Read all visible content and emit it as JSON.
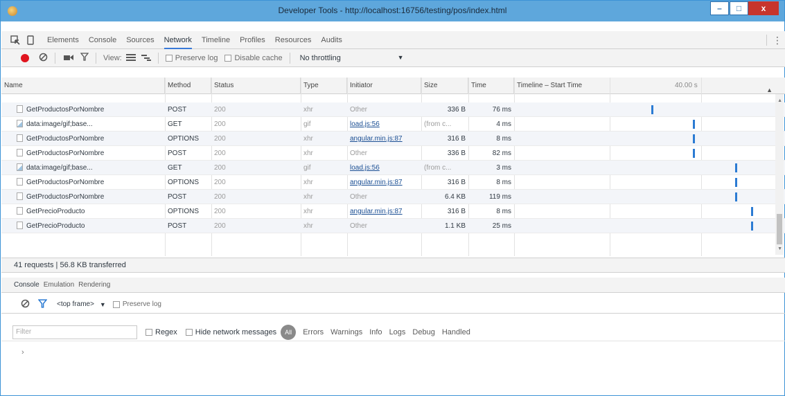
{
  "window": {
    "title": "Developer Tools - http://localhost:16756/testing/pos/index.html",
    "minimize": "–",
    "maximize": "□",
    "close": "x"
  },
  "tabs": [
    "Elements",
    "Console",
    "Sources",
    "Network",
    "Timeline",
    "Profiles",
    "Resources",
    "Audits"
  ],
  "active_tab": "Network",
  "network_toolbar": {
    "view_label": "View:",
    "preserve_log": "Preserve log",
    "disable_cache": "Disable cache",
    "throttling": "No throttling"
  },
  "columns": {
    "name": "Name",
    "method": "Method",
    "status": "Status",
    "type": "Type",
    "initiator": "Initiator",
    "size": "Size",
    "time": "Time",
    "timeline": "Timeline – Start Time",
    "ms_marker": "40.00 s"
  },
  "requests": [
    {
      "name": "GetProductosPorNombre",
      "method": "POST",
      "status": "200",
      "type": "xhr",
      "initiator": "Other",
      "initiator_link": false,
      "size": "336 B",
      "time": "76 ms",
      "icon": "doc",
      "wf": 0.52
    },
    {
      "name": "data:image/gif;base...",
      "method": "GET",
      "status": "200",
      "type": "gif",
      "initiator": "load.js:56",
      "initiator_link": true,
      "size": "(from c...",
      "time": "4 ms",
      "icon": "img",
      "wf": 0.68
    },
    {
      "name": "GetProductosPorNombre",
      "method": "OPTIONS",
      "status": "200",
      "type": "xhr",
      "initiator": "angular.min.js:87",
      "initiator_link": true,
      "size": "316 B",
      "time": "8 ms",
      "icon": "doc",
      "wf": 0.68
    },
    {
      "name": "GetProductosPorNombre",
      "method": "POST",
      "status": "200",
      "type": "xhr",
      "initiator": "Other",
      "initiator_link": false,
      "size": "336 B",
      "time": "82 ms",
      "icon": "doc",
      "wf": 0.68
    },
    {
      "name": "data:image/gif;base...",
      "method": "GET",
      "status": "200",
      "type": "gif",
      "initiator": "load.js:56",
      "initiator_link": true,
      "size": "(from c...",
      "time": "3 ms",
      "icon": "img",
      "wf": 0.84
    },
    {
      "name": "GetProductosPorNombre",
      "method": "OPTIONS",
      "status": "200",
      "type": "xhr",
      "initiator": "angular.min.js:87",
      "initiator_link": true,
      "size": "316 B",
      "time": "8 ms",
      "icon": "doc",
      "wf": 0.84
    },
    {
      "name": "GetProductosPorNombre",
      "method": "POST",
      "status": "200",
      "type": "xhr",
      "initiator": "Other",
      "initiator_link": false,
      "size": "6.4 KB",
      "time": "119 ms",
      "icon": "doc",
      "wf": 0.84
    },
    {
      "name": "GetPrecioProducto",
      "method": "OPTIONS",
      "status": "200",
      "type": "xhr",
      "initiator": "angular.min.js:87",
      "initiator_link": true,
      "size": "316 B",
      "time": "8 ms",
      "icon": "doc",
      "wf": 0.9
    },
    {
      "name": "GetPrecioProducto",
      "method": "POST",
      "status": "200",
      "type": "xhr",
      "initiator": "Other",
      "initiator_link": false,
      "size": "1.1 KB",
      "time": "25 ms",
      "icon": "doc",
      "wf": 0.9
    }
  ],
  "status_bar": "41 requests | 56.8 KB transferred",
  "drawer_tabs": [
    "Console",
    "Emulation",
    "Rendering"
  ],
  "console_toolbar": {
    "frame": "<top frame>",
    "preserve_log": "Preserve log"
  },
  "filter_bar": {
    "placeholder": "Filter",
    "regex": "Regex",
    "hide_network": "Hide network messages",
    "all": "All",
    "levels": [
      "Errors",
      "Warnings",
      "Info",
      "Logs",
      "Debug",
      "Handled"
    ]
  },
  "console_prompt": "›",
  "colors": {
    "titlebar": "#5ea7dc",
    "record": "#e0141e",
    "waterfall": "#2b7bd3",
    "link": "#1a4e93"
  }
}
